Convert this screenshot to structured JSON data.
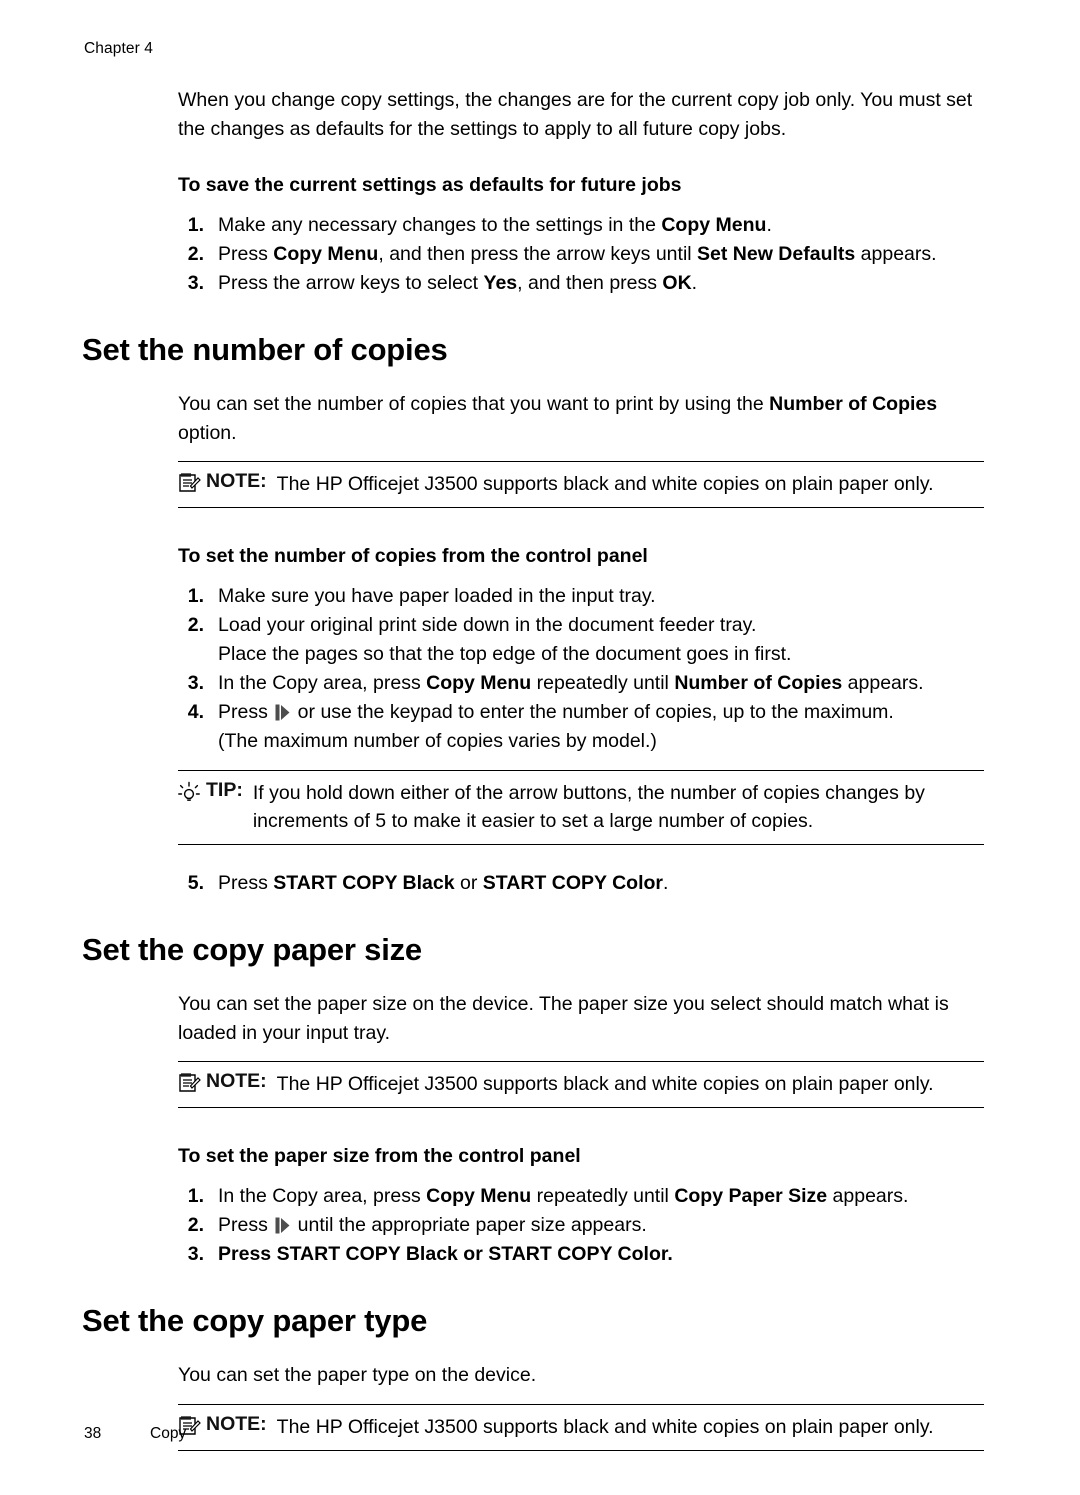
{
  "header": {
    "chapter": "Chapter 4"
  },
  "footer": {
    "page_number": "38",
    "section": "Copy"
  },
  "intro": {
    "paragraph": "When you change copy settings, the changes are for the current copy job only. You must set the changes as defaults for the settings to apply to all future copy jobs."
  },
  "proc_defaults": {
    "title": "To save the current settings as defaults for future jobs",
    "steps": [
      {
        "num": "1.",
        "parts": [
          {
            "t": "Make any necessary changes to the settings in the "
          },
          {
            "t": "Copy Menu",
            "b": true
          },
          {
            "t": "."
          }
        ]
      },
      {
        "num": "2.",
        "parts": [
          {
            "t": "Press "
          },
          {
            "t": "Copy Menu",
            "b": true
          },
          {
            "t": ", and then press the arrow keys until "
          },
          {
            "t": "Set New Defaults",
            "b": true
          },
          {
            "t": " appears."
          }
        ]
      },
      {
        "num": "3.",
        "parts": [
          {
            "t": "Press the arrow keys to select "
          },
          {
            "t": "Yes",
            "b": true
          },
          {
            "t": ", and then press "
          },
          {
            "t": "OK",
            "b": true
          },
          {
            "t": "."
          }
        ]
      }
    ]
  },
  "section_copies": {
    "heading": "Set the number of copies",
    "paragraph_parts": [
      {
        "t": "You can set the number of copies that you want to print by using the "
      },
      {
        "t": "Number of Copies",
        "b": true
      },
      {
        "t": " option."
      }
    ],
    "note": {
      "icon": "note-icon",
      "label": "NOTE:",
      "text": "The HP Officejet J3500 supports black and white copies on plain paper only."
    },
    "proc_title": "To set the number of copies from the control panel",
    "steps": [
      {
        "num": "1.",
        "parts": [
          {
            "t": "Make sure you have paper loaded in the input tray."
          }
        ]
      },
      {
        "num": "2.",
        "parts": [
          {
            "t": "Load your original print side down in the document feeder tray."
          }
        ],
        "sub": "Place the pages so that the top edge of the document goes in first."
      },
      {
        "num": "3.",
        "parts": [
          {
            "t": "In the Copy area, press "
          },
          {
            "t": "Copy Menu",
            "b": true
          },
          {
            "t": " repeatedly until "
          },
          {
            "t": "Number of Copies",
            "b": true
          },
          {
            "t": " appears."
          }
        ]
      },
      {
        "num": "4.",
        "parts": [
          {
            "t": "Press "
          },
          {
            "t": "",
            "icon": "right-arrow-key-icon"
          },
          {
            "t": " or use the keypad to enter the number of copies, up to the maximum."
          }
        ],
        "sub": "(The maximum number of copies varies by model.)"
      }
    ],
    "tip": {
      "icon": "tip-icon",
      "label": "TIP:",
      "text": "If you hold down either of the arrow buttons, the number of copies changes by increments of 5 to make it easier to set a large number of copies."
    },
    "final_step": {
      "num": "5.",
      "parts": [
        {
          "t": "Press "
        },
        {
          "t": "START COPY Black",
          "b": true
        },
        {
          "t": " or "
        },
        {
          "t": "START COPY Color",
          "b": true
        },
        {
          "t": "."
        }
      ]
    }
  },
  "section_paper_size": {
    "heading": "Set the copy paper size",
    "paragraph": "You can set the paper size on the device. The paper size you select should match what is loaded in your input tray.",
    "note": {
      "icon": "note-icon",
      "label": "NOTE:",
      "text": "The HP Officejet J3500 supports black and white copies on plain paper only."
    },
    "proc_title": "To set the paper size from the control panel",
    "steps": [
      {
        "num": "1.",
        "parts": [
          {
            "t": "In the Copy area, press "
          },
          {
            "t": "Copy Menu",
            "b": true
          },
          {
            "t": " repeatedly until "
          },
          {
            "t": "Copy Paper Size",
            "b": true
          },
          {
            "t": " appears."
          }
        ]
      },
      {
        "num": "2.",
        "parts": [
          {
            "t": "Press "
          },
          {
            "t": "",
            "icon": "right-arrow-key-icon"
          },
          {
            "t": " until the appropriate paper size appears."
          }
        ]
      },
      {
        "num": "3.",
        "bold": true,
        "parts": [
          {
            "t": "Press "
          },
          {
            "t": "START COPY Black",
            "b": true
          },
          {
            "t": " or "
          },
          {
            "t": "START COPY Color",
            "b": true
          },
          {
            "t": "."
          }
        ]
      }
    ]
  },
  "section_paper_type": {
    "heading": "Set the copy paper type",
    "paragraph": "You can set the paper type on the device.",
    "note": {
      "icon": "note-icon",
      "label": "NOTE:",
      "text": "The HP Officejet J3500 supports black and white copies on plain paper only."
    }
  },
  "colors": {
    "text": "#000000",
    "rule": "#000000"
  }
}
